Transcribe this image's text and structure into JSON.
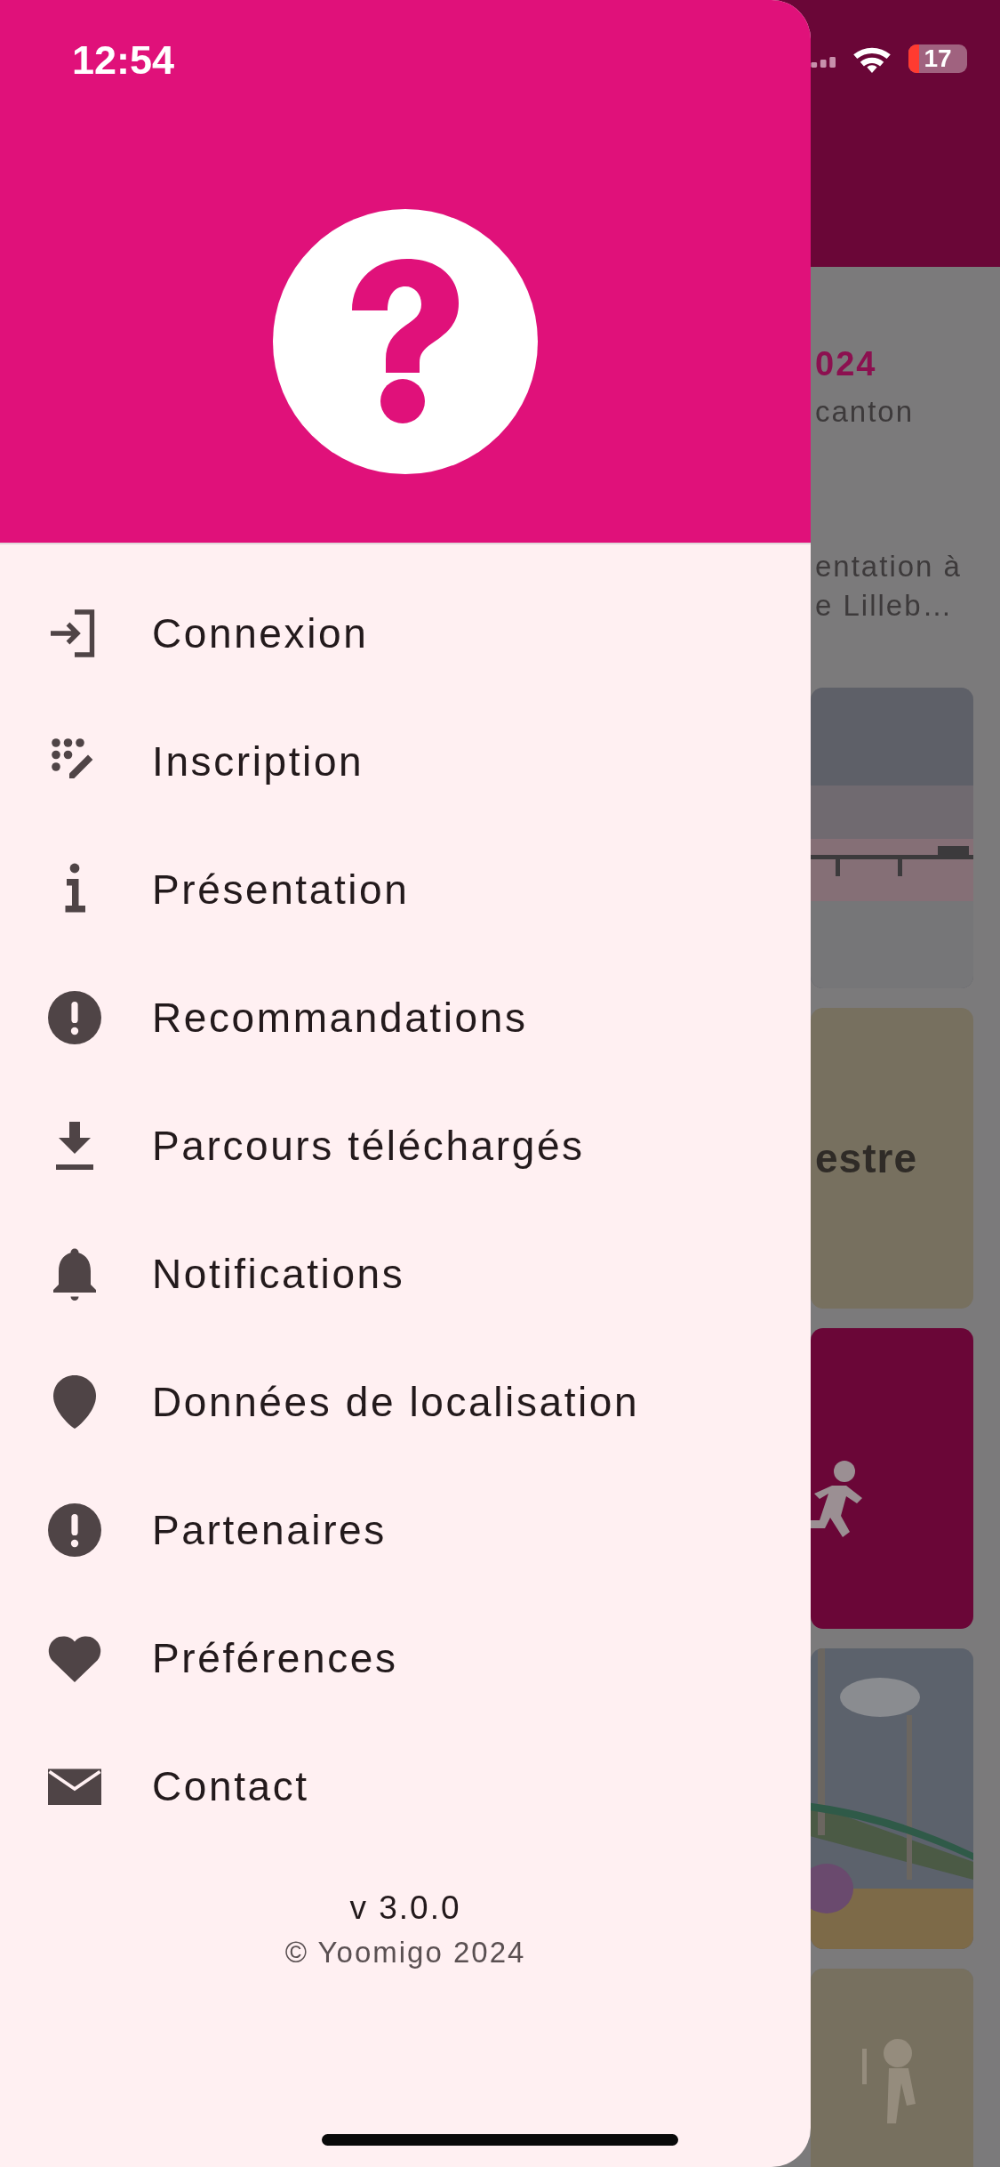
{
  "status_bar": {
    "time": "12:54",
    "battery": "17"
  },
  "drawer": {
    "menu": [
      {
        "kind": "login",
        "label": "Connexion"
      },
      {
        "kind": "signup",
        "label": "Inscription"
      },
      {
        "kind": "info",
        "label": "Présentation"
      },
      {
        "kind": "alert",
        "label": "Recommandations"
      },
      {
        "kind": "download",
        "label": "Parcours téléchargés"
      },
      {
        "kind": "bell",
        "label": "Notifications"
      },
      {
        "kind": "pin",
        "label": "Données de localisation"
      },
      {
        "kind": "alert",
        "label": "Partenaires"
      },
      {
        "kind": "heart",
        "label": "Préférences"
      },
      {
        "kind": "mail",
        "label": "Contact"
      }
    ],
    "footer": {
      "version": "v 3.0.0",
      "copyright": "© Yoomigo 2024"
    }
  },
  "background": {
    "texts": [
      {
        "kind": "date",
        "text": "024"
      },
      {
        "kind": "body",
        "text": "canton"
      },
      {
        "kind": "body",
        "text": "entation à"
      },
      {
        "kind": "body",
        "text": "e Lilleb…"
      }
    ],
    "cards": [
      {
        "kind": "picture"
      },
      {
        "kind": "title",
        "title": "estre"
      },
      {
        "kind": "activity"
      },
      {
        "kind": "picture"
      },
      {
        "kind": "picture"
      }
    ]
  }
}
